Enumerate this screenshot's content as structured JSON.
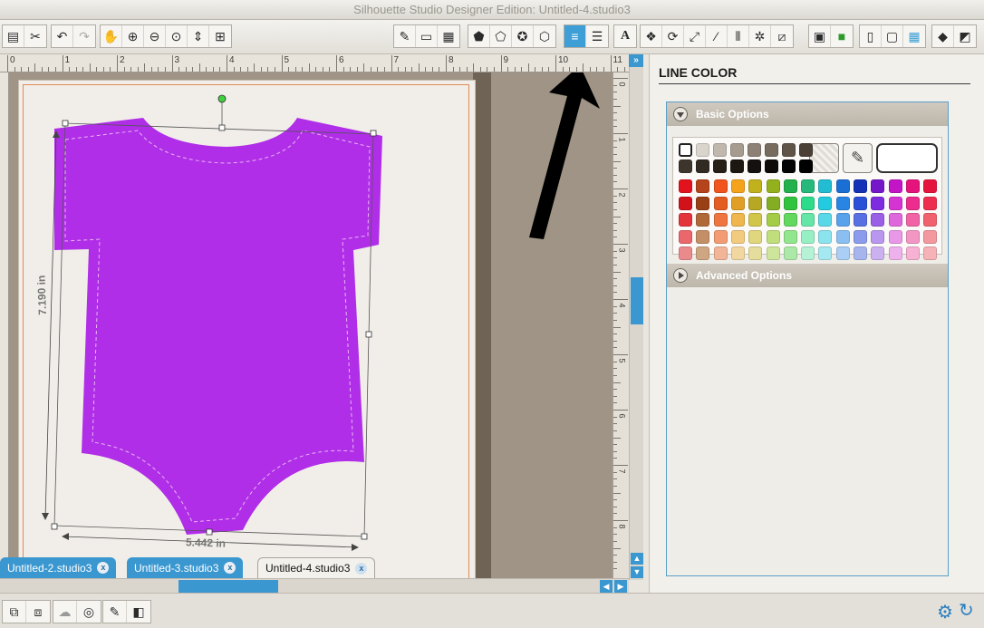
{
  "window": {
    "title": "Silhouette Studio Designer Edition: Untitled-4.studio3"
  },
  "toolbar": {
    "groups": [
      {
        "icons": [
          "paste-icon",
          "cut-icon"
        ]
      },
      {
        "icons": [
          "undo-icon",
          "redo-icon"
        ]
      },
      {
        "icons": [
          "pan-hand-icon",
          "zoom-in-icon",
          "zoom-out-icon",
          "zoom-select-icon",
          "zoom-drag-icon",
          "zoom-fit-icon"
        ]
      },
      {
        "icons": [
          "page-settings-icon",
          "cut-settings-icon",
          "grid-settings-icon"
        ]
      },
      {
        "icons": [
          "fill-color-icon",
          "fill-gradient-icon",
          "fill-pattern-icon",
          "line-color-icon"
        ]
      },
      {
        "icons": [
          "line-color-panel-icon",
          "line-style-icon"
        ]
      },
      {
        "icons": [
          "text-style-icon"
        ]
      },
      {
        "icons": [
          "replicate-icon",
          "rotate-icon",
          "scale-icon",
          "shear-icon",
          "align-icon",
          "offset-icon",
          "trace-icon"
        ]
      },
      {
        "icons": [
          "library-icon",
          "store-icon"
        ]
      },
      {
        "icons": [
          "send-to-silhouette-icon",
          "print-icon",
          "print-cut-icon"
        ]
      },
      {
        "icons": [
          "eraser-icon",
          "knife-icon"
        ]
      }
    ],
    "text_icon_label": "A"
  },
  "ruler": {
    "top_numbers": [
      "0",
      "1",
      "2",
      "3",
      "4",
      "5",
      "6",
      "7",
      "8",
      "9",
      "10",
      "11"
    ],
    "right_numbers": [
      "0",
      "1",
      "2",
      "3",
      "4",
      "5",
      "6",
      "7",
      "8"
    ]
  },
  "canvas": {
    "shape": {
      "type": "baby-onesie",
      "fill": "#b02ee8",
      "stitch_color": "#e8b6f0"
    },
    "dimension_height": "7.190 in",
    "dimension_width": "5.442 in"
  },
  "tabs": [
    {
      "label": "Untitled-2.studio3",
      "close": "x",
      "active": false
    },
    {
      "label": "Untitled-3.studio3",
      "close": "x",
      "active": false
    },
    {
      "label": "Untitled-4.studio3",
      "close": "x",
      "active": true
    }
  ],
  "scroll": {
    "expand_label": "»",
    "up": "▲",
    "down": "▼",
    "left": "◀",
    "right": "▶"
  },
  "bottombar": {
    "left_icons": [
      "group-icon",
      "ungroup-icon",
      "compound-path-icon",
      "release-compound-icon",
      "point-edit-icon",
      "weld-icon"
    ],
    "right_icons": [
      "settings-gear-icon",
      "refresh-icon"
    ]
  },
  "panel": {
    "title": "LINE COLOR",
    "basic_options": "Basic Options",
    "advanced_options": "Advanced Options",
    "palette": {
      "row1": [
        "#f7f6f2",
        "#d9d4cc",
        "#c0b8ad",
        "#a59b8f",
        "#8c8174",
        "#766b5d",
        "#5f5447",
        "#4a4036"
      ],
      "row2": [
        "#3d352c",
        "#312a22",
        "#261f18",
        "#1d1712",
        "#141010",
        "#0d0a08",
        "#050404",
        "#000000"
      ],
      "rows": [
        [
          "#e3131d",
          "#b5431b",
          "#f2541d",
          "#f5a31b",
          "#c1b11d",
          "#93b11c",
          "#22b14c",
          "#27b97b",
          "#23bcd2",
          "#1b6fd4",
          "#1531b6",
          "#7517c8",
          "#c315c5",
          "#e5147c",
          "#e5143e"
        ],
        [
          "#d2121a",
          "#994016",
          "#e35c22",
          "#e0a027",
          "#b6a825",
          "#85ad23",
          "#32c33e",
          "#2ddb8a",
          "#24cbe0",
          "#2985e3",
          "#2a50d7",
          "#7e2ce0",
          "#d633d3",
          "#ec2d8e",
          "#ed2e4f"
        ],
        [
          "#e4343b",
          "#b06a3a",
          "#ef7540",
          "#eeb64d",
          "#d2c64a",
          "#a4cc46",
          "#62d85e",
          "#65e6a6",
          "#5ad8e8",
          "#5aa1ec",
          "#5970e2",
          "#9a5fe6",
          "#df67dc",
          "#f063a4",
          "#f0626e"
        ],
        [
          "#ea676b",
          "#c48f66",
          "#f39c73",
          "#f3cb7f",
          "#e0d67d",
          "#c0de7c",
          "#92e68e",
          "#97efc4",
          "#8be3ee",
          "#8bbff2",
          "#8a9ceb",
          "#b997ee",
          "#e898e6",
          "#f496c4",
          "#f4989f"
        ],
        [
          "#ea8a8c",
          "#cfa682",
          "#f3b597",
          "#f3d7a0",
          "#e5dd9c",
          "#cfe59c",
          "#ace9a9",
          "#b6f2d6",
          "#a6e8f1",
          "#aacef5",
          "#a7b5ef",
          "#ccb1f1",
          "#eeb1ec",
          "#f6b1d3",
          "#f6b2b6"
        ]
      ]
    }
  }
}
